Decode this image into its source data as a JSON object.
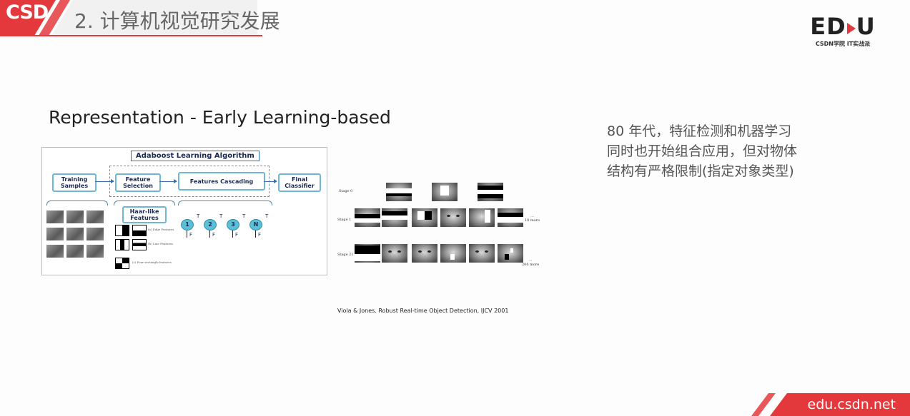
{
  "header": {
    "ribbon_text": "CSD",
    "title": "2. 计算机视觉研究发展",
    "colors": {
      "accent": "#e4393c",
      "title": "#666666"
    }
  },
  "logo": {
    "main_left": "ED",
    "main_right": "U",
    "sub": "CSDN学院   IT实战派"
  },
  "figure": {
    "heading": "Representation - Early Learning-based",
    "diagram": {
      "title": "Adaboost Learning Algorithm",
      "nodes": {
        "training": "Training Samples",
        "selection": "Feature Selection",
        "cascading": "Features Cascading",
        "final": "Final Classifier",
        "haar": "Haar-like Features"
      },
      "haar_captions": [
        "(a) Edge Features",
        "(b) Line Features",
        "(c) Four-rectangle features"
      ],
      "stages": [
        "1",
        "2",
        "3",
        "N"
      ],
      "true_label": "T",
      "false_label": "F"
    },
    "stages": {
      "stage0": "Stage 0",
      "stage1": "Stage 1",
      "stage21": "Stage 21",
      "more1": "10 more",
      "more21": "206 more",
      "ellipsis": "..."
    },
    "citation": "Viola & Jones. Robust Real-time  Object Detection,  IJCV 2001"
  },
  "side_text": {
    "line1": "80 年代，特征检测和机器学习",
    "line2": "同时也开始组合应用，但对物体",
    "line3": "结构有严格限制(指定对象类型)"
  },
  "footer": {
    "url": "edu.csdn.net",
    "color": "#e4393c"
  }
}
